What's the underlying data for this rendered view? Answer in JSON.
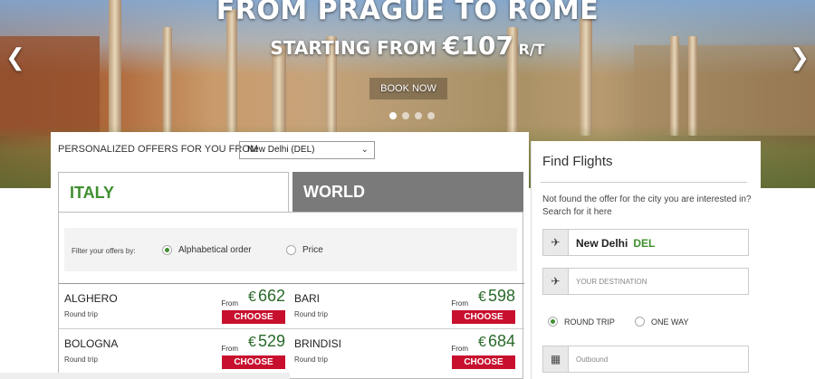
{
  "hero": {
    "title": "FROM PRAGUE TO ROME",
    "sub_prefix": "STARTING FROM ",
    "sub_price": "€107",
    "sub_suffix": " R/T",
    "book_label": "BOOK NOW",
    "slides_total": 4,
    "active_slide": 1
  },
  "offers": {
    "label": "PERSONALIZED OFFERS FOR YOU FROM",
    "origin_value": "New Delhi (DEL)",
    "tabs": [
      "ITALY",
      "WORLD"
    ],
    "filter_label": "Filter your offers by:",
    "filter_options": [
      "Alphabetical order",
      "Price"
    ],
    "items": [
      {
        "city": "ALGHERO",
        "trip": "Round trip",
        "from": "From",
        "currency": "€",
        "price": "662",
        "choose": "CHOOSE"
      },
      {
        "city": "BARI",
        "trip": "Round trip",
        "from": "From",
        "currency": "€",
        "price": "598",
        "choose": "CHOOSE"
      },
      {
        "city": "BOLOGNA",
        "trip": "Round trip",
        "from": "From",
        "currency": "€",
        "price": "529",
        "choose": "CHOOSE"
      },
      {
        "city": "BRINDISI",
        "trip": "Round trip",
        "from": "From",
        "currency": "€",
        "price": "684",
        "choose": "CHOOSE"
      }
    ]
  },
  "find_flights": {
    "title": "Find Flights",
    "text": "Not found the offer for the city you are interested in? Search for it here",
    "origin_city": "New Delhi",
    "origin_code": "DEL",
    "destination_placeholder": "YOUR DESTINATION",
    "trip_options": [
      "ROUND TRIP",
      "ONE WAY"
    ],
    "outbound_placeholder": "Outbound"
  },
  "colors": {
    "accent_green": "#3f8f2f",
    "choose_red": "#c8102e",
    "world_tab_gray": "#7a7a7a"
  }
}
